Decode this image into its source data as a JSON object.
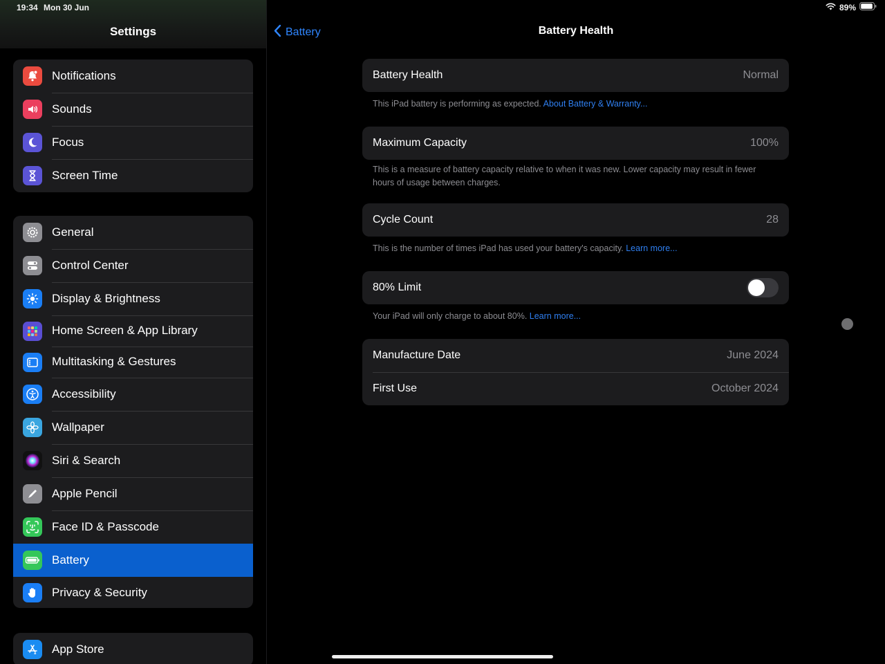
{
  "status": {
    "time": "19:34",
    "date": "Mon 30 Jun",
    "battery_pct": "89%"
  },
  "sidebar": {
    "title": "Settings",
    "groups": [
      [
        {
          "label": "Notifications",
          "icon": "bell-icon",
          "color": "#eb4b3f"
        },
        {
          "label": "Sounds",
          "icon": "speaker-icon",
          "color": "#eb3f5e"
        },
        {
          "label": "Focus",
          "icon": "moon-icon",
          "color": "#5b54d6"
        },
        {
          "label": "Screen Time",
          "icon": "hourglass-icon",
          "color": "#5b54d6"
        }
      ],
      [
        {
          "label": "General",
          "icon": "gear-icon",
          "color": "#8e8e93"
        },
        {
          "label": "Control Center",
          "icon": "toggles-icon",
          "color": "#8e8e93"
        },
        {
          "label": "Display & Brightness",
          "icon": "sun-icon",
          "color": "#1a7ef5"
        },
        {
          "label": "Home Screen & App Library",
          "icon": "grid-icon",
          "color": "#5a4ed3"
        },
        {
          "label": "Multitasking & Gestures",
          "icon": "multitask-icon",
          "color": "#1a7ef5"
        },
        {
          "label": "Accessibility",
          "icon": "accessibility-icon",
          "color": "#1a7ef5"
        },
        {
          "label": "Wallpaper",
          "icon": "flower-icon",
          "color": "#3aa6e0"
        },
        {
          "label": "Siri & Search",
          "icon": "siri-icon",
          "color": "#222"
        },
        {
          "label": "Apple Pencil",
          "icon": "pencil-icon",
          "color": "#8e8e93"
        },
        {
          "label": "Face ID & Passcode",
          "icon": "faceid-icon",
          "color": "#34c759"
        },
        {
          "label": "Battery",
          "icon": "battery-icon",
          "color": "#34c759",
          "selected": true
        },
        {
          "label": "Privacy & Security",
          "icon": "hand-icon",
          "color": "#1a7ef5"
        }
      ],
      [
        {
          "label": "App Store",
          "icon": "appstore-icon",
          "color": "#1a8cf2"
        }
      ]
    ]
  },
  "detail": {
    "back_label": "Battery",
    "title": "Battery Health",
    "battery_health": {
      "label": "Battery Health",
      "value": "Normal",
      "footer": "This iPad battery is performing as expected.",
      "footer_link": "About Battery & Warranty..."
    },
    "max_capacity": {
      "label": "Maximum Capacity",
      "value": "100%",
      "footer": "This is a measure of battery capacity relative to when it was new. Lower capacity may result in fewer hours of usage between charges."
    },
    "cycle_count": {
      "label": "Cycle Count",
      "value": "28",
      "footer": "This is the number of times iPad has used your battery's capacity.",
      "footer_link": "Learn more..."
    },
    "limit": {
      "label": "80% Limit",
      "on": false,
      "footer": "Your iPad will only charge to about 80%.",
      "footer_link": "Learn more..."
    },
    "manufacture": {
      "label": "Manufacture Date",
      "value": "June 2024"
    },
    "first_use": {
      "label": "First Use",
      "value": "October 2024"
    }
  }
}
